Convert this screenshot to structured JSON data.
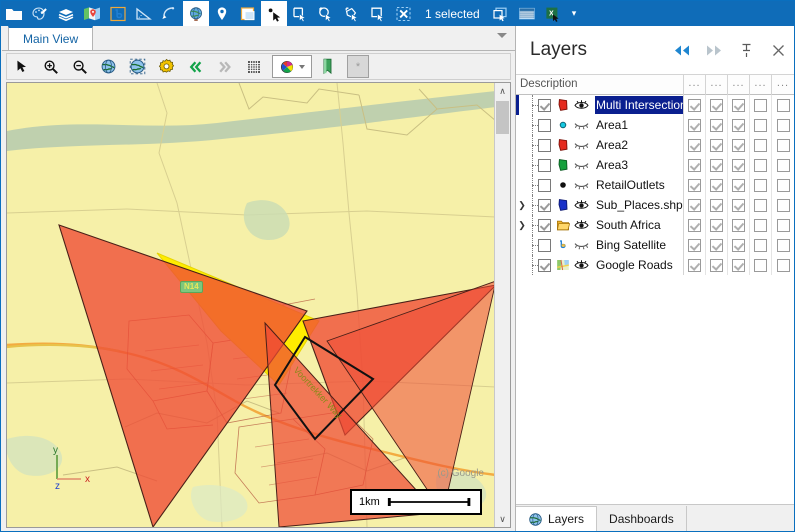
{
  "ribbon": {
    "buttons": [
      {
        "name": "open-folder-icon",
        "label": "Open",
        "active": false
      },
      {
        "name": "palette-settings-icon",
        "label": "Styling",
        "active": false
      },
      {
        "name": "layers-stack-icon",
        "label": "Layers",
        "active": false
      },
      {
        "name": "map-pin-icon",
        "label": "Map",
        "active": false
      },
      {
        "name": "bing-logo-icon",
        "label": "Bing Satellite",
        "active": false
      },
      {
        "name": "measure-angle-icon",
        "label": "Measure",
        "active": false
      },
      {
        "name": "measure-curve-icon",
        "label": "Measure Curve",
        "active": false
      },
      {
        "name": "globe-icon",
        "label": "Globe",
        "active": true
      },
      {
        "name": "location-pin-icon",
        "label": "Location",
        "active": false
      },
      {
        "name": "window-icon",
        "label": "New Window",
        "active": false
      },
      {
        "name": "select-point-icon",
        "label": "Select Point",
        "active": true
      },
      {
        "name": "select-rect-icon",
        "label": "Select Rectangle",
        "active": false
      },
      {
        "name": "select-circle-icon",
        "label": "Select Circle",
        "active": false
      },
      {
        "name": "select-polygon-icon",
        "label": "Select Polygon",
        "active": false
      },
      {
        "name": "select-box-icon",
        "label": "Select Box",
        "active": false
      },
      {
        "name": "clear-selection-icon",
        "label": "Clear Selection",
        "active": false
      }
    ],
    "status_label": "1 selected",
    "trailing_buttons": [
      {
        "name": "copy-selection-icon",
        "label": "Copy Selection"
      },
      {
        "name": "table-view-icon",
        "label": "Table View"
      },
      {
        "name": "export-excel-icon",
        "label": "Export to Excel"
      }
    ],
    "overflow_caret": "▾"
  },
  "document": {
    "tabs": [
      {
        "label": "Main View",
        "active": true
      }
    ],
    "overflow_caret": "▾",
    "map_toolbar": [
      {
        "name": "pointer-tool-icon",
        "label": "Pointer"
      },
      {
        "name": "zoom-in-icon",
        "label": "Zoom In"
      },
      {
        "name": "zoom-out-icon",
        "label": "Zoom Out"
      },
      {
        "name": "globe-extent-icon",
        "label": "Zoom to World"
      },
      {
        "name": "globe-layer-icon",
        "label": "Zoom to Layer"
      },
      {
        "name": "settings-gear-icon",
        "label": "Settings"
      },
      {
        "name": "previous-extent-icon",
        "label": "Previous Extent"
      },
      {
        "name": "next-extent-icon",
        "label": "Next Extent"
      },
      {
        "name": "grid-icon",
        "label": "Grid"
      },
      {
        "name": "color-palette-icon",
        "label": "Color Palette"
      },
      {
        "name": "bookmark-icon",
        "label": "Bookmark"
      },
      {
        "name": "asterisk-button",
        "label": "*"
      }
    ]
  },
  "map": {
    "road_label": "N14",
    "street_label": "Voortrekker Way",
    "attribution": "(c) Google",
    "scale_label": "1km",
    "axis": {
      "x": "x",
      "y": "y",
      "z": "z"
    },
    "colors": {
      "basemap": "#f7f2b0",
      "land": "#f5efa2",
      "polygon_red": "#ef4a35",
      "polygon_yellow": "#ffec00",
      "river": "#b9ccae",
      "road_major": "#f2a63b",
      "outline_dark": "#111111"
    },
    "scrollbar": {
      "up_arrow": "∧",
      "down_arrow": "∨"
    }
  },
  "panel": {
    "title": "Layers",
    "header_buttons": [
      {
        "name": "collapse-left-icon",
        "label": "◀◀"
      },
      {
        "name": "collapse-right-icon",
        "label": "▶▶"
      },
      {
        "name": "pin-icon",
        "label": "Pin"
      },
      {
        "name": "close-panel-icon",
        "label": "×"
      }
    ],
    "grid_header": {
      "description": "Description",
      "dot_columns": [
        "...",
        "...",
        "...",
        "...",
        "..."
      ]
    },
    "layers": [
      {
        "name": "Multi Intersection Layer",
        "checked": true,
        "visible": true,
        "icon": "polygon-red",
        "expandable": false,
        "selected": true,
        "cols": [
          true,
          true,
          true,
          false,
          false
        ]
      },
      {
        "name": "Area1",
        "checked": false,
        "visible": false,
        "icon": "point-cyan",
        "expandable": false,
        "selected": false,
        "cols": [
          true,
          true,
          true,
          false,
          false
        ]
      },
      {
        "name": "Area2",
        "checked": false,
        "visible": false,
        "icon": "polygon-red",
        "expandable": false,
        "selected": false,
        "cols": [
          true,
          true,
          true,
          false,
          false
        ]
      },
      {
        "name": "Area3",
        "checked": false,
        "visible": false,
        "icon": "polygon-green",
        "expandable": false,
        "selected": false,
        "cols": [
          true,
          true,
          true,
          false,
          false
        ]
      },
      {
        "name": "RetailOutlets",
        "checked": false,
        "visible": false,
        "icon": "point-black",
        "expandable": false,
        "selected": false,
        "cols": [
          true,
          true,
          true,
          false,
          false
        ]
      },
      {
        "name": "Sub_Places.shp",
        "checked": true,
        "visible": true,
        "icon": "polygon-blue",
        "expandable": true,
        "selected": false,
        "cols": [
          true,
          true,
          true,
          false,
          false
        ]
      },
      {
        "name": "South Africa",
        "checked": true,
        "visible": true,
        "icon": "folder-yellow",
        "expandable": true,
        "selected": false,
        "cols": [
          true,
          true,
          true,
          false,
          false
        ]
      },
      {
        "name": "Bing Satellite",
        "checked": false,
        "visible": false,
        "icon": "bing-logo",
        "expandable": false,
        "selected": false,
        "cols": [
          true,
          true,
          true,
          false,
          false
        ]
      },
      {
        "name": "Google Roads",
        "checked": true,
        "visible": true,
        "icon": "google-map",
        "expandable": false,
        "selected": false,
        "cols": [
          true,
          true,
          true,
          false,
          false
        ]
      }
    ],
    "bottom_tabs": [
      {
        "label": "Layers",
        "active": true,
        "icon": "globe-icon"
      },
      {
        "label": "Dashboards",
        "active": false,
        "icon": ""
      }
    ]
  }
}
